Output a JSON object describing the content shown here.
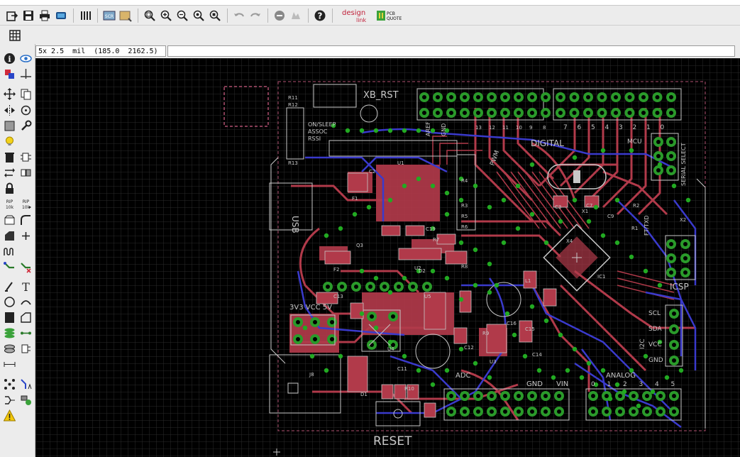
{
  "coord_readout": "5x 2.5  mil  (185.0  2162.5)",
  "command_line": "",
  "logos": {
    "designlink_top": "design",
    "designlink_bottom": "link",
    "pcbquote_top": "PCB",
    "pcbquote_bottom": "QUOTE"
  },
  "toolbar": {
    "scr_label": "SCR"
  },
  "lefttoolbar": {
    "rip1_label": "RIP",
    "rip1_sub": "10k",
    "rip2_label": "RIP",
    "rip2_sub": "10k"
  },
  "board": {
    "labels": {
      "xb_rst": "XB_RST",
      "digital": "DIGITAL",
      "usb": "USB",
      "icsp": "ICSP",
      "reset": "RESET",
      "analog": "ANALOG",
      "power_pins": "3V3  VCC  5V",
      "adc": "ADC",
      "vin": "VIN",
      "gnd_bottom": "GND",
      "on_sleep": "ON/SLEEP",
      "assoc": "ASSOC",
      "rssi": "RSSI",
      "pwm": "PWM",
      "mcu": "MCU",
      "serial_select": "SERIAL SELECT",
      "ftdi": "FT/TXD",
      "scl": "SCL",
      "sda": "SDA",
      "vcc": "VCC",
      "gnd": "GND",
      "i2c": "I2C",
      "aref": "AREF",
      "gnd_top": "GND"
    },
    "parts": [
      "R11",
      "R12",
      "R13",
      "C2",
      "F1",
      "F2",
      "Q3",
      "C13",
      "C19",
      "C16",
      "C11",
      "C12",
      "C15",
      "C14",
      "C7",
      "C3",
      "C9",
      "R1",
      "R2",
      "R3",
      "R4",
      "R5",
      "R6",
      "R7",
      "R8",
      "R9",
      "R10",
      "U1",
      "U2",
      "U3",
      "U4",
      "U5",
      "IC1",
      "J8",
      "D1",
      "D2",
      "L1",
      "X1",
      "X2",
      "X4"
    ],
    "analog_pins": [
      "0",
      "1",
      "2",
      "3",
      "4",
      "5"
    ],
    "digital_pins": [
      "7",
      "6",
      "5",
      "4",
      "3",
      "2",
      "1",
      "0"
    ],
    "digital_pins_upper": [
      "13",
      "12",
      "11",
      "10",
      "9",
      "8"
    ]
  },
  "colors": {
    "canvas_bg": "#000000",
    "grid": "#2a2a2a",
    "top_copper": "#b13a4a",
    "bottom_copper": "#3a3acc",
    "pads": "#2a9a2a",
    "vias": "#22aa22",
    "silkscreen": "#c8c8c8",
    "dimension": "#b05070"
  }
}
